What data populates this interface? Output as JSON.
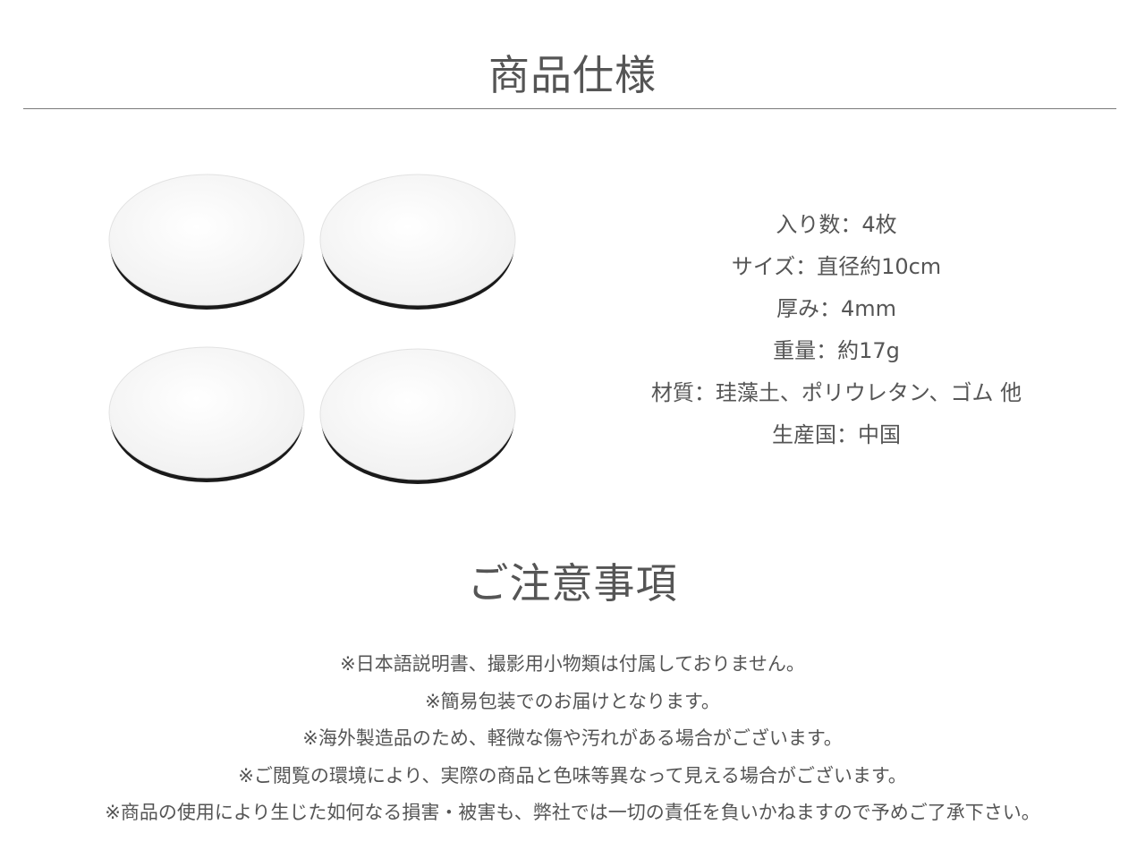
{
  "spec": {
    "title": "商品仕様",
    "items": [
      "入り数：4枚",
      "サイズ：直径約10cm",
      "厚み：4mm",
      "重量：約17g",
      "材質：珪藻土、ポリウレタン、ゴム 他",
      "生産国：中国"
    ]
  },
  "notes": {
    "title": "ご注意事項",
    "items": [
      "※日本語説明書、撮影用小物類は付属しておりません。",
      "※簡易包装でのお届けとなります。",
      "※海外製造品のため、軽微な傷や汚れがある場合がございます。",
      "※ご閲覧の環境により、実際の商品と色味等異なって見える場合がございます。",
      "※商品の使用により生じた如何なる損害・被害も、弊社では一切の責任を負いかねますので予めご了承下さい。"
    ]
  },
  "product_image": {
    "icon": "coaster-set-image",
    "coaster_count": 4,
    "colors": {
      "top": "#f7f7f7",
      "edge": "#1a1a1a",
      "shadow": "#d9d9d9"
    }
  },
  "colors": {
    "text": "#555555",
    "rule": "#7a7a7a",
    "background": "#ffffff"
  }
}
